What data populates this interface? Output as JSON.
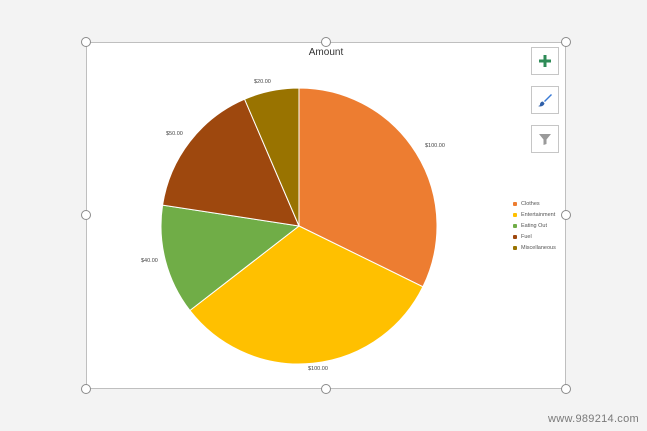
{
  "chart_data": {
    "type": "pie",
    "title": "Amount",
    "categories": [
      "Clothes",
      "Entertainment",
      "Eating Out",
      "Fuel",
      "Miscellaneous"
    ],
    "values": [
      100,
      100,
      40,
      50,
      20
    ],
    "data_labels": [
      "$100.00",
      "$100.00",
      "$40.00",
      "$50.00",
      "$20.00"
    ],
    "colors": [
      "#ED7D31",
      "#FFC000",
      "#70AD47",
      "#9E480E",
      "#997300"
    ],
    "legend_position": "right"
  },
  "toolbar": {
    "add_icon": "plus-icon",
    "style_icon": "brush-icon",
    "filter_icon": "filter-icon"
  },
  "watermark": "www.989214.com"
}
